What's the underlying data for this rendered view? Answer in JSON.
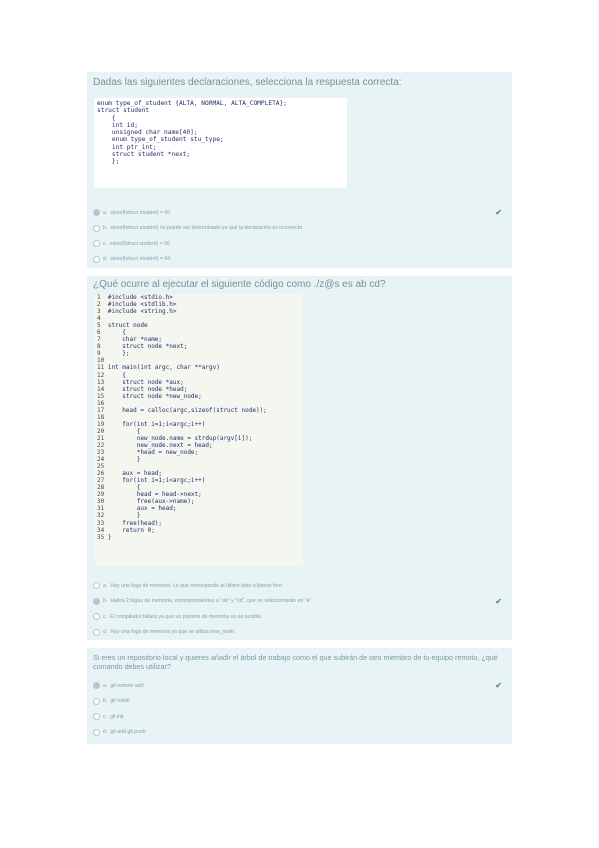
{
  "q1": {
    "question": "Dadas las siguientes declaraciones, selecciona la respuesta correcta:",
    "code": [
      "enum type_of_student {ALTA, NORMAL, ALTA_COMPLETA};",
      "struct student",
      "    {",
      "    int id;",
      "    unsigned char name[40];",
      "    enum type_of_student stu_type;",
      "    int ptr_int;",
      "    struct student *next;",
      "    };"
    ],
    "options": [
      {
        "letter": "a.",
        "text": "sizeof(struct student) = 60",
        "selected": true,
        "correct": true
      },
      {
        "letter": "b.",
        "text": "sizeof(struct student) no puede ser determinado ya que la declaración es incorrecta",
        "selected": false,
        "correct": false
      },
      {
        "letter": "c.",
        "text": "sizeof(struct student) = 56",
        "selected": false,
        "correct": false
      },
      {
        "letter": "d.",
        "text": "sizeof(struct student) = 64",
        "selected": false,
        "correct": false
      }
    ]
  },
  "q2": {
    "question": "¿Qué ocurre al ejecutar el siguiente código como ./z@s es ab cd?",
    "code": [
      {
        "n": "1",
        "t": "#include <stdio.h>"
      },
      {
        "n": "2",
        "t": "#include <stdlib.h>"
      },
      {
        "n": "3",
        "t": "#include <string.h>"
      },
      {
        "n": "4",
        "t": ""
      },
      {
        "n": "5",
        "t": "struct node"
      },
      {
        "n": "6",
        "t": "    {"
      },
      {
        "n": "7",
        "t": "    char *name;"
      },
      {
        "n": "8",
        "t": "    struct node *next;"
      },
      {
        "n": "9",
        "t": "    };"
      },
      {
        "n": "10",
        "t": ""
      },
      {
        "n": "11",
        "t": "int main(int argc, char **argv)"
      },
      {
        "n": "12",
        "t": "    {"
      },
      {
        "n": "13",
        "t": "    struct node *aux;"
      },
      {
        "n": "14",
        "t": "    struct node *head;"
      },
      {
        "n": "15",
        "t": "    struct node *new_node;"
      },
      {
        "n": "16",
        "t": ""
      },
      {
        "n": "17",
        "t": "    head = calloc(argc,sizeof(struct node));"
      },
      {
        "n": "18",
        "t": ""
      },
      {
        "n": "19",
        "t": "    for(int i=1;i<argc;i++)"
      },
      {
        "n": "20",
        "t": "        {"
      },
      {
        "n": "21",
        "t": "        new_node.name = strdup(argv[i]);"
      },
      {
        "n": "22",
        "t": "        new_node.next = head;"
      },
      {
        "n": "23",
        "t": "        *head = new_node;"
      },
      {
        "n": "24",
        "t": "        }"
      },
      {
        "n": "25",
        "t": ""
      },
      {
        "n": "26",
        "t": "    aux = head;"
      },
      {
        "n": "27",
        "t": "    for(int i=1;i<argc;i++)"
      },
      {
        "n": "28",
        "t": "        {"
      },
      {
        "n": "29",
        "t": "        head = head->next;"
      },
      {
        "n": "30",
        "t": "        free(aux->name);"
      },
      {
        "n": "31",
        "t": "        aux = head;"
      },
      {
        "n": "32",
        "t": "        }"
      },
      {
        "n": "33",
        "t": "    free(head);"
      },
      {
        "n": "34",
        "t": "    return 0;"
      },
      {
        "n": "35",
        "t": "}"
      }
    ],
    "options": [
      {
        "letter": "a.",
        "text": "Hay una fuga de memoria. Lo que corresponde al último dato a liberar free.",
        "selected": false,
        "correct": false
      },
      {
        "letter": "b.",
        "text": "Habrá 2 fugas de memoria, correspondientes a \"ab\" y \"cd\", que se seleccionarán en \"a\".",
        "selected": true,
        "correct": true
      },
      {
        "letter": "c.",
        "text": "El compilador fallará ya que un puntero de memoria no es posible.",
        "selected": false,
        "correct": false
      },
      {
        "letter": "d.",
        "text": "Hay una fuga de memoria ya que se utiliza new_node.",
        "selected": false,
        "correct": false
      }
    ]
  },
  "q3": {
    "question": "Si eres un repositorio local y quieres añadir el árbol de trabajo como el que subirán de otro miembro de tu equipo remoto, ¿qué comando debes utilizar?",
    "options": [
      {
        "letter": "a.",
        "text": "git remote add",
        "selected": true,
        "correct": true
      },
      {
        "letter": "b.",
        "text": "git mkdir",
        "selected": false,
        "correct": false
      },
      {
        "letter": "c.",
        "text": "git init",
        "selected": false,
        "correct": false
      },
      {
        "letter": "d.",
        "text": "git add git push",
        "selected": false,
        "correct": false
      }
    ]
  },
  "icons": {
    "check": "✔"
  }
}
